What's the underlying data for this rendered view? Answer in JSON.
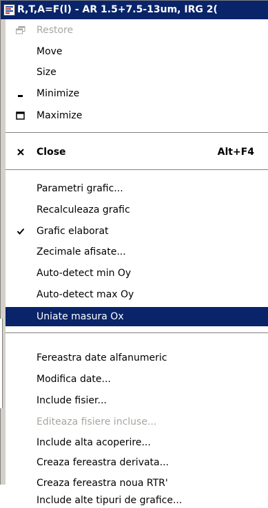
{
  "window": {
    "title": "R,T,A=F(l) - AR 1.5+7.5-13um, IRG 2(",
    "icon": "chart-window-icon"
  },
  "colors": {
    "titlebar": "#0a246a",
    "highlight": "#0a246a",
    "disabled_text": "#a7a6a0",
    "menu_bg": "#ffffff"
  },
  "menu": {
    "restore": {
      "label": "Restore",
      "icon": "restore-icon",
      "enabled": false
    },
    "move": {
      "label": "Move"
    },
    "size": {
      "label": "Size"
    },
    "minimize": {
      "label": "Minimize",
      "icon": "minimize-icon"
    },
    "maximize": {
      "label": "Maximize",
      "icon": "maximize-icon"
    },
    "close": {
      "label": "Close",
      "shortcut": "Alt+F4",
      "icon": "close-icon"
    },
    "parametri": {
      "label": "Parametri grafic..."
    },
    "recalculeaza": {
      "label": "Recalculeaza grafic"
    },
    "grafic_elaborat": {
      "label": "Grafic elaborat",
      "checked": true,
      "icon": "checkmark-icon"
    },
    "zecimale": {
      "label": "Zecimale afisate..."
    },
    "autodetect_min": {
      "label": "Auto-detect min Oy"
    },
    "autodetect_max": {
      "label": "Auto-detect max Oy"
    },
    "uniate": {
      "label": "Uniate masura Ox",
      "selected": true
    },
    "fereastra_date": {
      "label": "Fereastra date alfanumeric"
    },
    "modifica": {
      "label": "Modifica date..."
    },
    "include_fisier": {
      "label": "Include fisier..."
    },
    "editeaza": {
      "label": "Editeaza fisiere incluse...",
      "enabled": false
    },
    "include_acoperire": {
      "label": "Include alta acoperire..."
    },
    "creaza_derivata": {
      "label": "Creaza fereastra derivata..."
    },
    "creaza_rtr": {
      "label": "Creaza fereastra noua RTR'"
    },
    "include_tipuri": {
      "label": "Include alte tipuri de grafice..."
    }
  }
}
